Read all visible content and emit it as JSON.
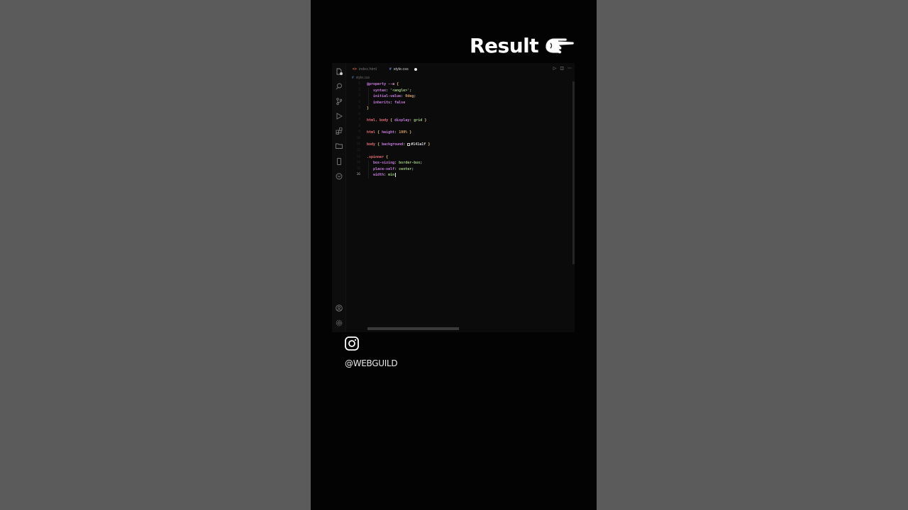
{
  "heading": {
    "text": "Result"
  },
  "editor": {
    "tabs": [
      {
        "glyph": "<>",
        "label": "index.html",
        "active": false
      },
      {
        "glyph": "#",
        "label": "style.css",
        "active": true,
        "modified": true
      }
    ],
    "breadcrumb": {
      "glyph": "#",
      "label": "style.css"
    },
    "activity_icons": [
      "files-icon",
      "search-icon",
      "source-control-icon",
      "run-debug-icon",
      "extensions-icon",
      "explorer-folder-icon",
      "phone-icon",
      "remote-icon",
      "account-icon",
      "settings-gear-icon"
    ],
    "actions": [
      "run-icon",
      "split-editor-icon",
      "more-icon"
    ],
    "current_line": "16",
    "lines": [
      {
        "n": "1"
      },
      {
        "n": "2"
      },
      {
        "n": "3"
      },
      {
        "n": "4"
      },
      {
        "n": "5"
      },
      {
        "n": "6"
      },
      {
        "n": "7"
      },
      {
        "n": "8"
      },
      {
        "n": "9"
      },
      {
        "n": "10"
      },
      {
        "n": "11"
      },
      {
        "n": "12"
      },
      {
        "n": "13"
      },
      {
        "n": "14"
      },
      {
        "n": "15"
      },
      {
        "n": "16"
      }
    ],
    "code": {
      "l1": {
        "at": "@property",
        "name": "--a",
        "brace": "{"
      },
      "l2": {
        "prop": "syntax",
        "value": "'<angle>'"
      },
      "l3": {
        "prop": "initial-value",
        "value": "0deg"
      },
      "l4": {
        "prop": "inherits",
        "value": "false"
      },
      "l5": {
        "brace": "}"
      },
      "l7": {
        "sel": "html, body",
        "prop": "display",
        "value": "grid"
      },
      "l9": {
        "sel": "html",
        "prop": "height",
        "value": "100%"
      },
      "l11": {
        "sel": "body",
        "prop": "background",
        "value": "#141a1f"
      },
      "l13": {
        "sel": ".spinner",
        "brace": "{"
      },
      "l14": {
        "prop": "box-sizing",
        "value": "border-box"
      },
      "l15": {
        "prop": "place-self",
        "value": "center"
      },
      "l16": {
        "prop": "width",
        "value": "min"
      }
    }
  },
  "social": {
    "icon": "instagram-icon",
    "handle": "@WEBGUILD"
  },
  "colors": {
    "page_bg": "#5b5b5b",
    "frame_bg": "#030303",
    "editor_bg": "#0b0b0b"
  }
}
